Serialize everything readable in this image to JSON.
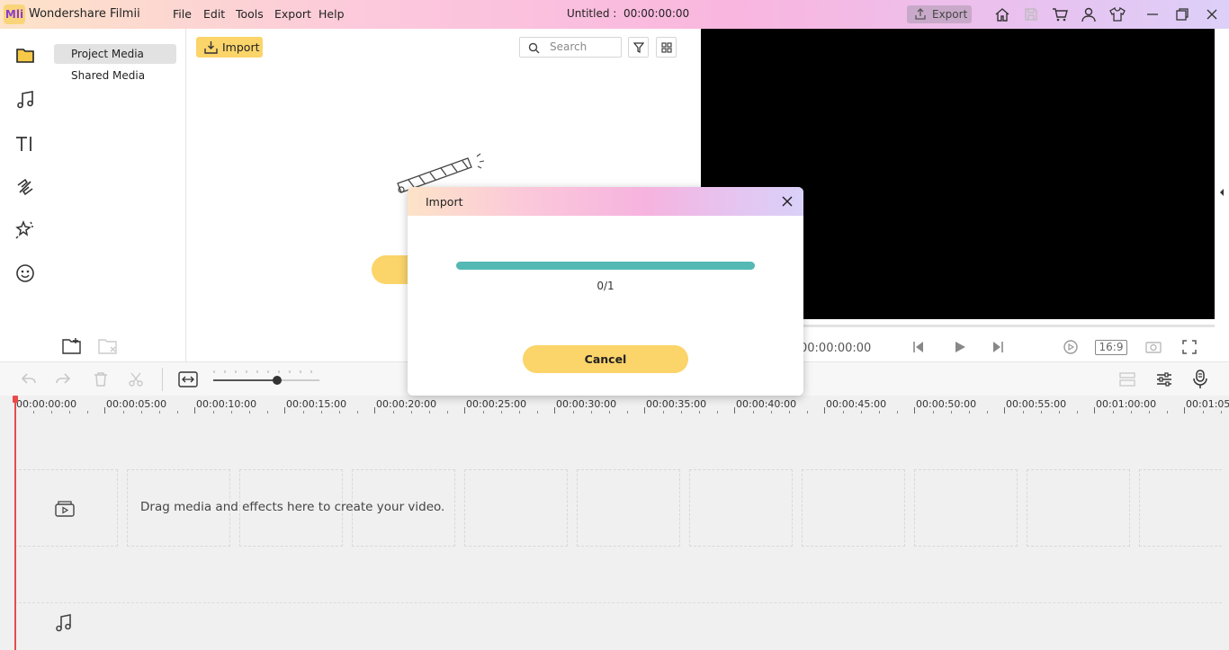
{
  "app": {
    "logo_text": "Mli",
    "name": "Wondershare Filmii",
    "menu": [
      "File",
      "Edit",
      "Tools",
      "Export",
      "Help"
    ],
    "doc_title": "Untitled :",
    "doc_time": "00:00:00:00",
    "export_label": "Export"
  },
  "sidebar": {
    "categories": [
      "Project Media",
      "Shared Media"
    ]
  },
  "media": {
    "import_label": "Import",
    "search_placeholder": "Search"
  },
  "preview": {
    "timecode": "00:00:00:00",
    "aspect": "16:9"
  },
  "timeline": {
    "ruler_labels": [
      "00:00:00:00",
      "00:00:05:00",
      "00:00:10:00",
      "00:00:15:00",
      "00:00:20:00",
      "00:00:25:00",
      "00:00:30:00",
      "00:00:35:00",
      "00:00:40:00",
      "00:00:45:00",
      "00:00:50:00",
      "00:00:55:00",
      "00:01:00:00",
      "00:01:05"
    ],
    "drop_hint": "Drag media and effects here to create your video.",
    "zoom_level": 0.6
  },
  "dialog": {
    "title": "Import",
    "progress": 1.0,
    "count": "0/1",
    "cancel_label": "Cancel"
  },
  "colors": {
    "accent": "#fbd46a",
    "progress": "#54b9b4",
    "playhead": "#e94a4a"
  }
}
